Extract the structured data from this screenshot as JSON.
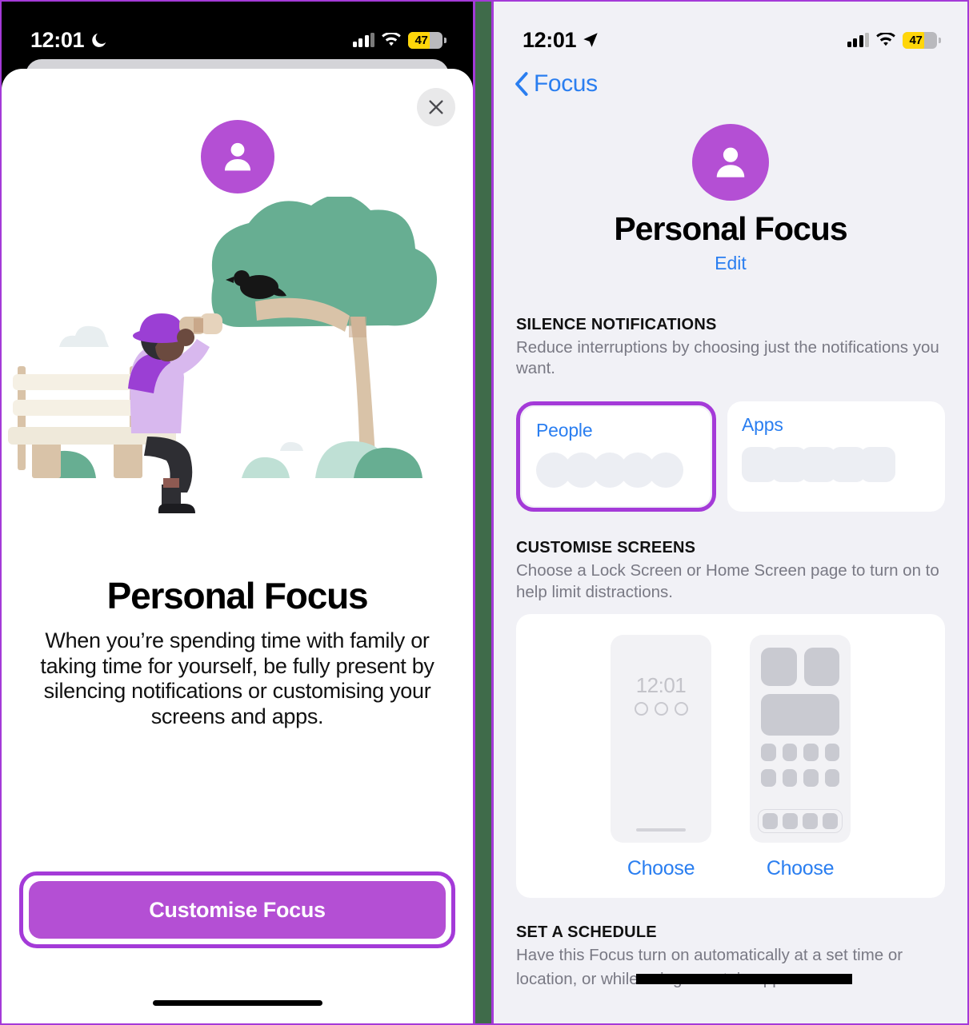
{
  "annotation": {
    "highlight_color": "#a43ad8",
    "divider_color": "#3f6b4a"
  },
  "left_panel": {
    "status_bar": {
      "time": "12:01",
      "moon_icon": "crescent-moon-icon",
      "signal_icon": "cellular-signal-icon",
      "wifi_icon": "wifi-icon",
      "battery_level": "47",
      "battery_color": "#FFD60A"
    },
    "sheet": {
      "close_label": "close-icon",
      "avatar_icon": "person-icon",
      "avatar_color": "#B44FD4",
      "illustration": "person-birdwatching-on-bench-illustration",
      "title": "Personal Focus",
      "body": "When you’re spending time with family or taking time for yourself, be fully present by silencing notifications or customising your screens and apps.",
      "cta_label": "Customise Focus",
      "cta_color": "#B44FD4"
    }
  },
  "right_panel": {
    "status_bar": {
      "time": "12:01",
      "location_icon": "location-arrow-icon",
      "signal_icon": "cellular-signal-icon",
      "wifi_icon": "wifi-icon",
      "battery_level": "47",
      "battery_color": "#FFD60A"
    },
    "nav": {
      "back_label": "Focus",
      "back_icon": "chevron-left-icon"
    },
    "header": {
      "avatar_icon": "person-icon",
      "avatar_color": "#B44FD4",
      "title": "Personal Focus",
      "edit_label": "Edit"
    },
    "sections": [
      {
        "heading": "SILENCE NOTIFICATIONS",
        "subtitle": "Reduce interruptions by choosing just the notifications you want.",
        "cards": [
          {
            "label": "People",
            "placeholder_shape": "circle",
            "placeholder_count": 5,
            "highlighted": true
          },
          {
            "label": "Apps",
            "placeholder_shape": "square",
            "placeholder_count": 5,
            "highlighted": false
          }
        ]
      },
      {
        "heading": "CUSTOMISE SCREENS",
        "subtitle": "Choose a Lock Screen or Home Screen page to turn on to help limit distractions.",
        "previews": [
          {
            "type": "lock-screen",
            "time": "12:01",
            "dots": 3,
            "choose_label": "Choose"
          },
          {
            "type": "home-screen",
            "choose_label": "Choose"
          }
        ]
      },
      {
        "heading": "SET A SCHEDULE",
        "subtitle_line1": "Have this Focus turn on automatically at a set time or",
        "subtitle_line2": "location, or while using a certain app.",
        "redacted": true
      }
    ]
  }
}
